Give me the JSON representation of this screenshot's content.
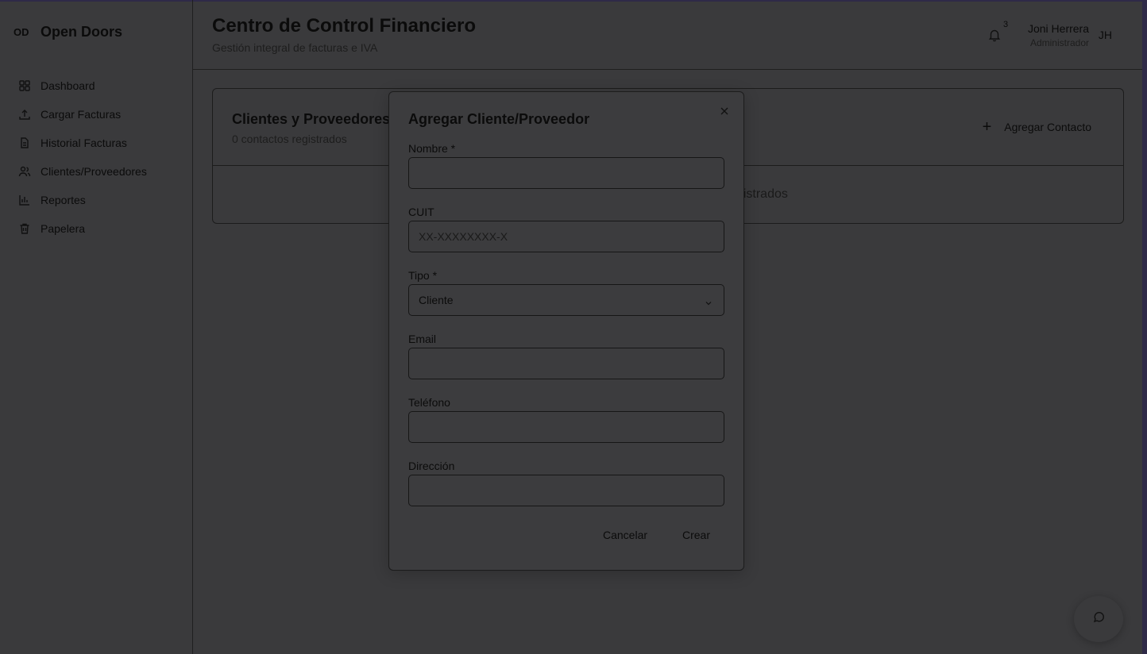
{
  "brand": {
    "mark": "OD",
    "name": "Open Doors"
  },
  "sidebar": {
    "items": [
      {
        "label": "Dashboard",
        "icon": "dashboard-icon"
      },
      {
        "label": "Cargar Facturas",
        "icon": "upload-icon"
      },
      {
        "label": "Historial Facturas",
        "icon": "file-text-icon"
      },
      {
        "label": "Clientes/Proveedores",
        "icon": "users-icon"
      },
      {
        "label": "Reportes",
        "icon": "bar-chart-icon"
      },
      {
        "label": "Papelera",
        "icon": "trash-icon"
      }
    ]
  },
  "header": {
    "title": "Centro de Control Financiero",
    "subtitle": "Gestión integral de facturas e IVA",
    "notifications_count": "3",
    "user_name": "Joni Herrera",
    "user_role": "Administrador",
    "avatar_initials": "JH"
  },
  "card": {
    "title": "Clientes y Proveedores",
    "count_text": "0 contactos registrados",
    "add_button": "Agregar Contacto",
    "empty_message": "No hay clientes o proveedores registrados"
  },
  "modal": {
    "title": "Agregar Cliente/Proveedor",
    "fields": {
      "nombre": {
        "label": "Nombre *",
        "value": "",
        "placeholder": ""
      },
      "cuit": {
        "label": "CUIT",
        "value": "",
        "placeholder": "XX-XXXXXXXX-X"
      },
      "tipo": {
        "label": "Tipo *",
        "value": "Cliente"
      },
      "email": {
        "label": "Email",
        "value": "",
        "placeholder": ""
      },
      "telefono": {
        "label": "Teléfono",
        "value": "",
        "placeholder": ""
      },
      "direccion": {
        "label": "Dirección",
        "value": "",
        "placeholder": ""
      }
    },
    "cancel_label": "Cancelar",
    "create_label": "Crear"
  },
  "colors": {
    "overlay_background": "#3a3a3c",
    "frame_accent": "#2f2a48",
    "text": "#0b0b0b"
  }
}
